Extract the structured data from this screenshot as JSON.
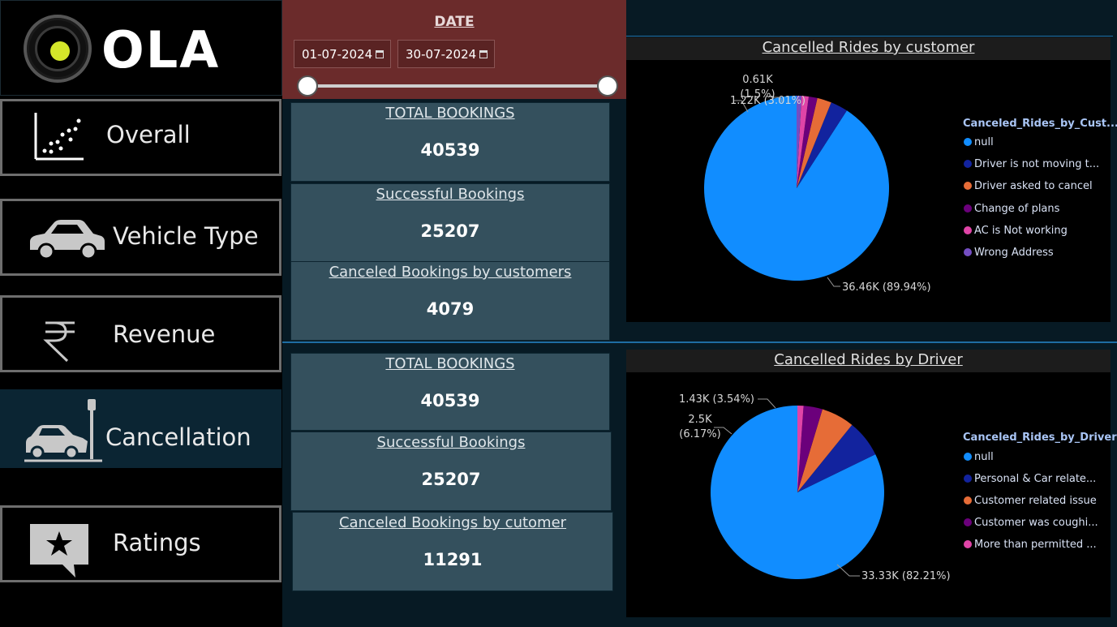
{
  "logo": {
    "text": "OLA"
  },
  "nav": [
    {
      "id": "overall",
      "label": "Overall",
      "icon": "scatter-chart-icon"
    },
    {
      "id": "vehicle",
      "label": "Vehicle Type",
      "icon": "car-icon"
    },
    {
      "id": "revenue",
      "label": "Revenue",
      "icon": "rupee-icon"
    },
    {
      "id": "cancellation",
      "label": "Cancellation",
      "icon": "car-crash-icon",
      "active": true
    },
    {
      "id": "ratings",
      "label": "Ratings",
      "icon": "star-speech-bubble-icon"
    }
  ],
  "date_filter": {
    "title": "DATE",
    "start": "01-07-2024",
    "end": "30-07-2024"
  },
  "kpis_top": [
    {
      "title": "TOTAL BOOKINGS",
      "value": "40539"
    },
    {
      "title": "Successful Bookings",
      "value": "25207"
    },
    {
      "title": "Canceled Bookings by customers",
      "value": "4079"
    }
  ],
  "kpis_bottom": [
    {
      "title": "TOTAL BOOKINGS",
      "value": "40539"
    },
    {
      "title": "Successful Bookings",
      "value": "25207"
    },
    {
      "title": "Canceled Bookings by cutomer",
      "value": "11291"
    }
  ],
  "chart_data": [
    {
      "type": "pie",
      "title": "Cancelled Rides by customer",
      "legend_title": "Canceled_Rides_by_Cust...",
      "legend_placement": "right",
      "slices": [
        {
          "label": "null",
          "value": 36.46,
          "percent": 89.94,
          "color": "#118dff",
          "data_label": "36.46K (89.94%)"
        },
        {
          "label": "Driver is not moving t...",
          "value": 1.22,
          "percent": 3.01,
          "color": "#12239e",
          "data_label": "1.22K (3.01%)"
        },
        {
          "label": "Driver asked to cancel",
          "value": 1.0,
          "percent": 2.47,
          "color": "#e66c37",
          "data_label": ""
        },
        {
          "label": "Change of plans",
          "value": 0.61,
          "percent": 1.5,
          "color": "#6b007b",
          "data_label": "0.61K (1.5%)"
        },
        {
          "label": "AC is Not working",
          "value": 0.5,
          "percent": 1.23,
          "color": "#e044a7",
          "data_label": ""
        },
        {
          "label": "Wrong Address",
          "value": 0.34,
          "percent": 0.84,
          "color": "#744ec2",
          "data_label": ""
        }
      ]
    },
    {
      "type": "pie",
      "title": "Cancelled Rides by Driver",
      "legend_title": "Canceled_Rides_by_Driver",
      "legend_placement": "right",
      "slices": [
        {
          "label": "null",
          "value": 33.33,
          "percent": 82.21,
          "color": "#118dff",
          "data_label": "33.33K (82.21%)"
        },
        {
          "label": "Personal & Car relate...",
          "value": 2.82,
          "percent": 6.96,
          "color": "#12239e",
          "data_label": ""
        },
        {
          "label": "Customer related issue",
          "value": 2.5,
          "percent": 6.17,
          "color": "#e66c37",
          "data_label": "2.5K (6.17%)"
        },
        {
          "label": "Customer was coughi...",
          "value": 1.43,
          "percent": 3.54,
          "color": "#6b007b",
          "data_label": "1.43K (3.54%)"
        },
        {
          "label": "More than permitted ...",
          "value": 0.46,
          "percent": 1.12,
          "color": "#e044a7",
          "data_label": ""
        }
      ]
    }
  ]
}
